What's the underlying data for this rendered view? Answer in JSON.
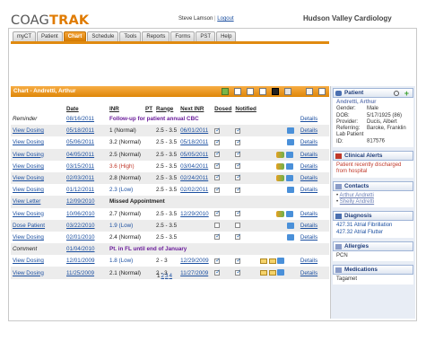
{
  "brand": {
    "part1": "COAG",
    "part2": "TRAK"
  },
  "user": {
    "name": "Steve Lamson",
    "sep": " | ",
    "logout": "Logout"
  },
  "clinic": "Hudson Valley Cardiology",
  "tabs": [
    {
      "label": "myCT",
      "active": false
    },
    {
      "label": "Patient",
      "active": false
    },
    {
      "label": "Chart",
      "active": true
    },
    {
      "label": "Schedule",
      "active": false
    },
    {
      "label": "Tools",
      "active": false
    },
    {
      "label": "Reports",
      "active": false
    },
    {
      "label": "Forms",
      "active": false
    },
    {
      "label": "PST",
      "active": false
    },
    {
      "label": "Help",
      "active": false
    }
  ],
  "chart": {
    "title": "Chart - Andretti, Arthur",
    "columns": [
      "Date",
      "INR",
      "PT",
      "Range",
      "Next INR",
      "Dosed",
      "Notified"
    ],
    "rows": [
      {
        "action": "Reminder",
        "action_style": "it",
        "date": "08/16/2011",
        "full": "Follow-up for patient annual CBC",
        "full_style": "note",
        "details": "Details"
      },
      {
        "action": "View Dosing",
        "date": "05/18/2011",
        "inr": "1 (Normal)",
        "inr_style": "",
        "range": "2.5 - 3.5",
        "next": "06/01/2011",
        "dosed": true,
        "notified": true,
        "icons": "pen",
        "details": "Details"
      },
      {
        "action": "View Dosing",
        "date": "05/06/2011",
        "inr": "3.2 (Normal)",
        "inr_style": "",
        "range": "2.5 - 3.5",
        "next": "05/18/2011",
        "dosed": true,
        "notified": true,
        "icons": "pen",
        "details": "Details"
      },
      {
        "action": "View Dosing",
        "date": "04/05/2011",
        "inr": "2.5 (Normal)",
        "inr_style": "",
        "range": "2.5 - 3.5",
        "next": "05/05/2011",
        "dosed": true,
        "notified": true,
        "icons": "pill-pen",
        "details": "Details"
      },
      {
        "action": "View Dosing",
        "date": "03/15/2011",
        "inr": "3.6 (High)",
        "inr_style": "hi",
        "range": "2.5 - 3.5",
        "next": "03/04/2011",
        "dosed": true,
        "notified": true,
        "icons": "pill-pen",
        "details": "Details"
      },
      {
        "action": "View Dosing",
        "date": "02/03/2011",
        "inr": "2.8 (Normal)",
        "inr_style": "",
        "range": "2.5 - 3.5",
        "next": "02/24/2011",
        "dosed": true,
        "notified": true,
        "icons": "pill-pen",
        "details": "Details"
      },
      {
        "action": "View Dosing",
        "date": "01/12/2011",
        "inr": "2.3 (Low)",
        "inr_style": "lo",
        "range": "2.5 - 3.5",
        "next": "02/02/2011",
        "dosed": true,
        "notified": true,
        "icons": "pen",
        "details": "Details"
      },
      {
        "action": "View Letter",
        "date": "12/09/2010",
        "full": "Missed Appointment",
        "full_style": "miss",
        "details": ""
      },
      {
        "action": "View Dosing",
        "date": "10/06/2010",
        "inr": "2.7 (Normal)",
        "inr_style": "",
        "range": "2.5 - 3.5",
        "next": "12/29/2010",
        "dosed": true,
        "notified": true,
        "icons": "pill-pen",
        "details": "Details"
      },
      {
        "action": "Dose Patient",
        "date": "03/22/2010",
        "inr": "1.9 (Low)",
        "inr_style": "lo",
        "range": "2.5 - 3.5",
        "next": "",
        "dosed": false,
        "notified": false,
        "icons": "pen",
        "details": "Details"
      },
      {
        "action": "View Dosing",
        "date": "02/01/2010",
        "inr": "2.4 (Normal)",
        "inr_style": "",
        "range": "2.5 - 3.5",
        "next": "",
        "dosed": true,
        "notified": true,
        "icons": "pen",
        "details": "Details"
      },
      {
        "action": "Comment",
        "action_style": "it",
        "date": "01/04/2010",
        "full": "Pt. in FL until end of January",
        "full_style": "note",
        "details": ""
      },
      {
        "action": "View Dosing",
        "date": "12/01/2009",
        "inr": "1.8 (Low)",
        "inr_style": "lo",
        "range": "2 - 3",
        "next": "12/29/2009",
        "dosed": true,
        "notified": true,
        "icons": "env-pen",
        "details": "Details"
      },
      {
        "action": "View Dosing",
        "date": "11/25/2009",
        "inr": "2.1 (Normal)",
        "inr_style": "",
        "range": "2 - 3",
        "next": "11/27/2009",
        "dosed": true,
        "notified": true,
        "icons": "env-pen",
        "details": "Details"
      }
    ],
    "pager": [
      "1",
      "2",
      "3",
      "4"
    ]
  },
  "sidebar": {
    "patient_header": "Patient",
    "patient_name": "Andretti, Arthur",
    "fields": [
      {
        "label": "Gender:",
        "value": "Male"
      },
      {
        "label": "DOB:",
        "value": "5/17/1925 (86)"
      },
      {
        "label": "Provider:",
        "value": "Ducis, Albert"
      },
      {
        "label": "Referring:",
        "value": "Baroke, Franklin"
      },
      {
        "label": "Lab Patient ID:",
        "value": "817576"
      }
    ],
    "alerts_header": "Clinical Alerts",
    "alert_text": "Patient recently discharged from hospital",
    "contacts_header": "Contacts",
    "contacts": [
      "Arthur Andretti",
      "Shelly Andretti"
    ],
    "diagnosis_header": "Diagnosis",
    "diagnoses": [
      "427.31 Atrial Fibrillation",
      "427.32 Atrial Flutter"
    ],
    "allergies_header": "Allergies",
    "allergies": [
      "PCN"
    ],
    "medications_header": "Medications",
    "medications": [
      "Tagamet"
    ]
  },
  "colors": {
    "accent": "#e08a10",
    "link": "#1b4fa0",
    "high": "#c0392b",
    "note": "#6a1b9a"
  }
}
